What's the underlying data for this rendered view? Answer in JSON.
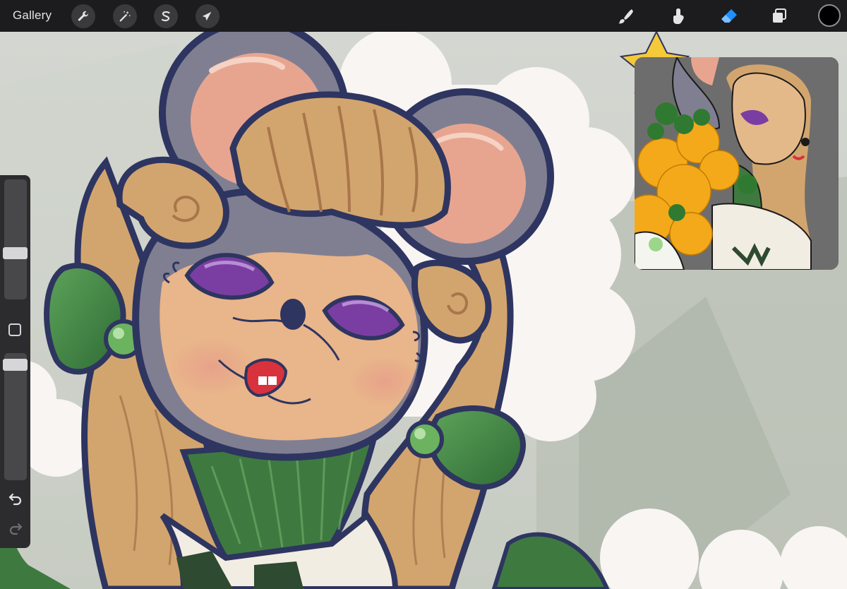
{
  "toolbar": {
    "gallery_label": "Gallery",
    "left_tools": [
      {
        "name": "actions",
        "icon": "wrench-icon"
      },
      {
        "name": "adjustments",
        "icon": "magic-wand-icon"
      },
      {
        "name": "selection",
        "icon": "selection-s-icon"
      },
      {
        "name": "transform",
        "icon": "arrow-cursor-icon"
      }
    ],
    "right_tools": [
      {
        "name": "brush",
        "icon": "brush-icon",
        "active": false
      },
      {
        "name": "smudge",
        "icon": "smudge-icon",
        "active": false
      },
      {
        "name": "eraser",
        "icon": "eraser-icon",
        "active": true
      },
      {
        "name": "layers",
        "icon": "layers-icon",
        "active": false
      }
    ],
    "current_color": "#000000",
    "active_color": "#1e90ff"
  },
  "sidebar": {
    "brush_size": 0.38,
    "brush_opacity": 1.0,
    "modify_icon": "square-icon",
    "undo_icon": "undo-icon",
    "redo_icon": "redo-icon"
  },
  "colors": {
    "outline": "#2e3560",
    "skin": "#e9b58a",
    "hair": "#d3a56e",
    "ear_gray": "#807f92",
    "ear_inner": "#e7a590",
    "eyeshadow": "#7a3ea2",
    "lips": "#d8323c",
    "green": "#3e7a40",
    "cloud": "#f8f5f3"
  }
}
